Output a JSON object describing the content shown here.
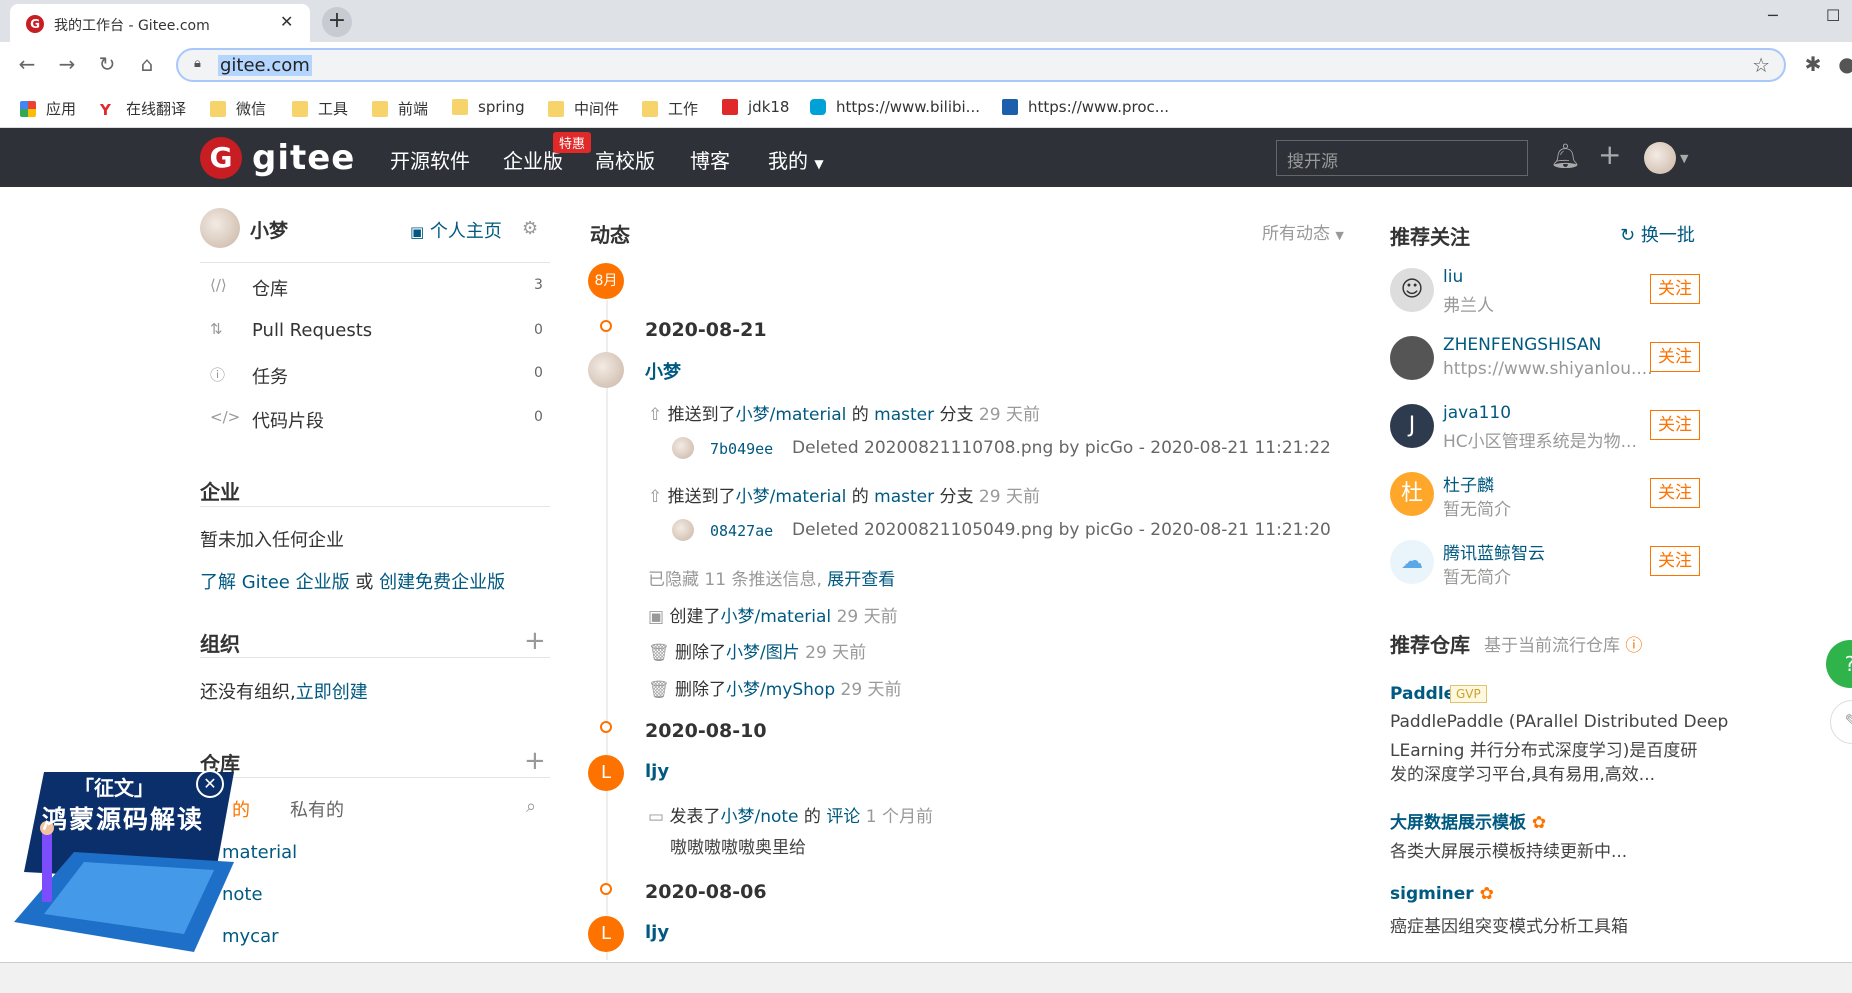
{
  "browser": {
    "tab_title": "我的工作台 - Gitee.com",
    "url": "gitee.com",
    "bookmarks": [
      {
        "label": "应用",
        "icon": "apps-grid-icon"
      },
      {
        "label": "在线翻译",
        "icon": "youdao-icon"
      },
      {
        "label": "微信",
        "icon": "folder-icon"
      },
      {
        "label": "工具",
        "icon": "folder-icon"
      },
      {
        "label": "前端",
        "icon": "folder-icon"
      },
      {
        "label": "spring",
        "icon": "folder-icon"
      },
      {
        "label": "中间件",
        "icon": "folder-icon"
      },
      {
        "label": "工作",
        "icon": "folder-icon"
      },
      {
        "label": "jdk18",
        "icon": "jdk-icon"
      },
      {
        "label": "https://www.bilibi...",
        "icon": "bilibili-icon"
      },
      {
        "label": "https://www.proc...",
        "icon": "processon-icon"
      }
    ]
  },
  "header": {
    "logo": "gitee",
    "nav": [
      "开源软件",
      "企业版",
      "高校版",
      "博客",
      "我的"
    ],
    "enterprise_badge": "特惠",
    "search_placeholder": "搜开源"
  },
  "sidebar": {
    "username": "小梦",
    "home_link": "个人主页",
    "items": [
      {
        "label": "仓库",
        "count": "3"
      },
      {
        "label": "Pull Requests",
        "count": "0"
      },
      {
        "label": "任务",
        "count": "0"
      },
      {
        "label": "代码片段",
        "count": "0"
      }
    ],
    "enterprise_title": "企业",
    "enterprise_none": "暂未加入任何企业",
    "enterprise_learn": "了解 Gitee 企业版",
    "enterprise_or": "或",
    "enterprise_create": "创建免费企业版",
    "org_title": "组织",
    "org_none": "还没有组织,",
    "org_create": "立即创建",
    "repo_title": "仓库",
    "repo_tabs": [
      "的",
      "私有的"
    ],
    "repos": [
      "material",
      "note",
      "mycar"
    ]
  },
  "feed": {
    "title": "动态",
    "filter": "所有动态",
    "month": "8月",
    "groups": [
      {
        "date": "2020-08-21",
        "user": "小梦",
        "events": [
          {
            "pre": "推送到了",
            "repo": "小梦/material",
            "mid": "的",
            "branch": "master",
            "post": "分支",
            "time": "29 天前",
            "commit": "7b049ee",
            "msg": "Deleted 20200821110708.png by picGo - 2020-08-21 11:21:22"
          },
          {
            "pre": "推送到了",
            "repo": "小梦/material",
            "mid": "的",
            "branch": "master",
            "post": "分支",
            "time": "29 天前",
            "commit": "08427ae",
            "msg": "Deleted 20200821105049.png by picGo - 2020-08-21 11:21:20"
          }
        ],
        "hidden": "已隐藏 11 条推送信息,",
        "expand": "展开查看",
        "others": [
          {
            "verb": "创建了",
            "target": "小梦/material",
            "time": "29 天前"
          },
          {
            "verb": "删除了",
            "target": "小梦/图片",
            "time": "29 天前"
          },
          {
            "verb": "删除了",
            "target": "小梦/myShop",
            "time": "29 天前"
          }
        ]
      },
      {
        "date": "2020-08-10",
        "user": "ljy",
        "comment_pre": "发表了",
        "comment_repo": "小梦/note",
        "comment_mid": "的",
        "comment_link": "评论",
        "comment_time": "1 个月前",
        "comment_text": "嗷嗷嗷嗷嗷奥里给"
      },
      {
        "date": "2020-08-06",
        "user": "ljy"
      }
    ]
  },
  "recommend": {
    "title": "推荐关注",
    "refresh": "换一批",
    "follow_label": "关注",
    "users": [
      {
        "name": "liu",
        "desc": "弗兰人"
      },
      {
        "name": "ZHENFENGSHISAN",
        "desc": "https://www.shiyanlou...."
      },
      {
        "name": "java110",
        "desc": "HC小区管理系统是为物...",
        "initial": "J"
      },
      {
        "name": "杜子麟",
        "desc": "暂无简介",
        "initial": "杜"
      },
      {
        "name": "腾讯蓝鲸智云",
        "desc": "暂无简介"
      }
    ],
    "repo_title": "推荐仓库",
    "repo_sub": "基于当前流行仓库",
    "repos": [
      {
        "name": "Paddle",
        "badge": "GVP",
        "desc1": "PaddlePaddle (PArallel Distributed Deep",
        "desc2": "LEarning 并行分布式深度学习)是百度研",
        "desc3": "发的深度学习平台,具有易用,高效..."
      },
      {
        "name": "大屏数据展示模板",
        "desc1": "各类大屏展示模板持续更新中..."
      },
      {
        "name": "sigminer",
        "desc1": "癌症基因组突变模式分析工具箱"
      }
    ]
  },
  "promo": {
    "line1": "「征文」",
    "line2": "鸿蒙源码解读"
  }
}
